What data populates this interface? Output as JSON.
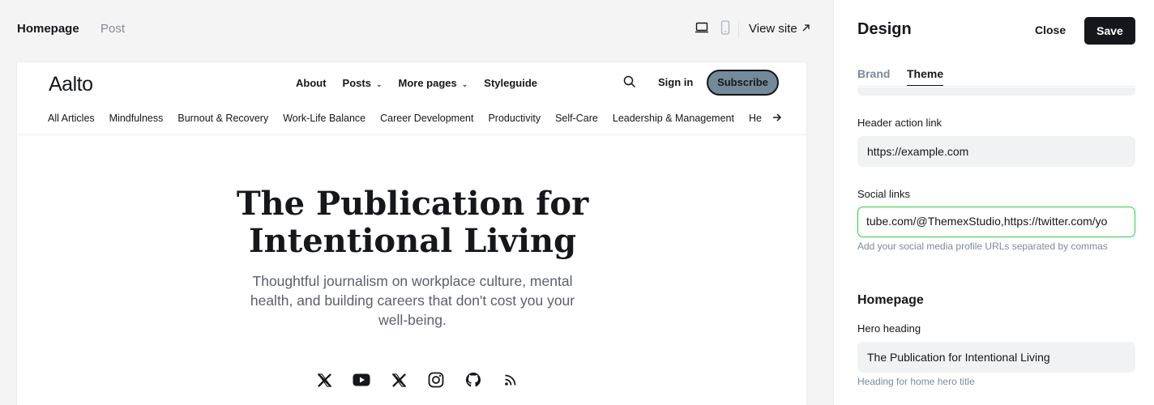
{
  "topbar": {
    "tabs": [
      "Homepage",
      "Post"
    ],
    "view_site": "View site"
  },
  "site": {
    "logo": "Aalto",
    "nav": [
      {
        "label": "About",
        "dropdown": false
      },
      {
        "label": "Posts",
        "dropdown": true
      },
      {
        "label": "More pages",
        "dropdown": true
      },
      {
        "label": "Styleguide",
        "dropdown": false
      }
    ],
    "sign_in": "Sign in",
    "subscribe": "Subscribe",
    "subscribe_color": "#738a9a",
    "categories": [
      "All Articles",
      "Mindfulness",
      "Burnout & Recovery",
      "Work-Life Balance",
      "Career Development",
      "Productivity",
      "Self-Care",
      "Leadership & Management",
      "He"
    ],
    "hero_heading": "The Publication for Intentional Living",
    "hero_sub": "Thoughtful journalism on workplace culture, mental health, and building careers that don't cost you your well-being.",
    "socials": [
      "x-icon",
      "youtube-icon",
      "x-icon",
      "instagram-icon",
      "github-icon",
      "rss-icon"
    ]
  },
  "panel": {
    "title": "Design",
    "close": "Close",
    "save": "Save",
    "tabs": [
      "Brand",
      "Theme"
    ],
    "active_tab": "Theme",
    "header_action_link": {
      "label": "Header action link",
      "value": "https://example.com"
    },
    "social_links": {
      "label": "Social links",
      "value": "tube.com/@ThemexStudio,https://twitter.com/yo",
      "hint": "Add your social media profile URLs separated by commas"
    },
    "homepage_section": "Homepage",
    "hero_heading": {
      "label": "Hero heading",
      "value": "The Publication for Intentional Living",
      "hint": "Heading for home hero title"
    },
    "focus_color": "#30cf43"
  }
}
